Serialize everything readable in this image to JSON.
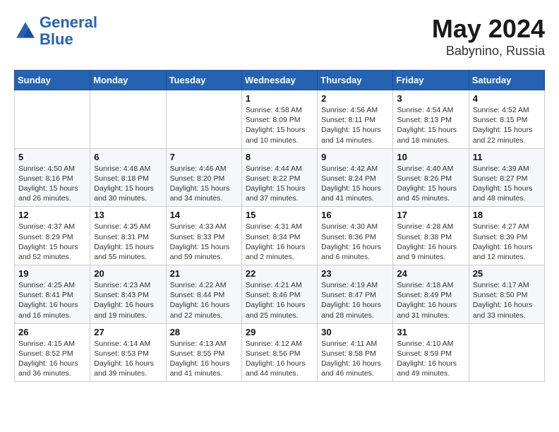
{
  "header": {
    "logo_line1": "General",
    "logo_line2": "Blue",
    "month_year": "May 2024",
    "location": "Babynino, Russia"
  },
  "weekdays": [
    "Sunday",
    "Monday",
    "Tuesday",
    "Wednesday",
    "Thursday",
    "Friday",
    "Saturday"
  ],
  "weeks": [
    [
      {
        "day": "",
        "info": ""
      },
      {
        "day": "",
        "info": ""
      },
      {
        "day": "",
        "info": ""
      },
      {
        "day": "1",
        "info": "Sunrise: 4:58 AM\nSunset: 8:09 PM\nDaylight: 15 hours\nand 10 minutes."
      },
      {
        "day": "2",
        "info": "Sunrise: 4:56 AM\nSunset: 8:11 PM\nDaylight: 15 hours\nand 14 minutes."
      },
      {
        "day": "3",
        "info": "Sunrise: 4:54 AM\nSunset: 8:13 PM\nDaylight: 15 hours\nand 18 minutes."
      },
      {
        "day": "4",
        "info": "Sunrise: 4:52 AM\nSunset: 8:15 PM\nDaylight: 15 hours\nand 22 minutes."
      }
    ],
    [
      {
        "day": "5",
        "info": "Sunrise: 4:50 AM\nSunset: 8:16 PM\nDaylight: 15 hours\nand 26 minutes."
      },
      {
        "day": "6",
        "info": "Sunrise: 4:48 AM\nSunset: 8:18 PM\nDaylight: 15 hours\nand 30 minutes."
      },
      {
        "day": "7",
        "info": "Sunrise: 4:46 AM\nSunset: 8:20 PM\nDaylight: 15 hours\nand 34 minutes."
      },
      {
        "day": "8",
        "info": "Sunrise: 4:44 AM\nSunset: 8:22 PM\nDaylight: 15 hours\nand 37 minutes."
      },
      {
        "day": "9",
        "info": "Sunrise: 4:42 AM\nSunset: 8:24 PM\nDaylight: 15 hours\nand 41 minutes."
      },
      {
        "day": "10",
        "info": "Sunrise: 4:40 AM\nSunset: 8:26 PM\nDaylight: 15 hours\nand 45 minutes."
      },
      {
        "day": "11",
        "info": "Sunrise: 4:39 AM\nSunset: 8:27 PM\nDaylight: 15 hours\nand 48 minutes."
      }
    ],
    [
      {
        "day": "12",
        "info": "Sunrise: 4:37 AM\nSunset: 8:29 PM\nDaylight: 15 hours\nand 52 minutes."
      },
      {
        "day": "13",
        "info": "Sunrise: 4:35 AM\nSunset: 8:31 PM\nDaylight: 15 hours\nand 55 minutes."
      },
      {
        "day": "14",
        "info": "Sunrise: 4:33 AM\nSunset: 8:33 PM\nDaylight: 15 hours\nand 59 minutes."
      },
      {
        "day": "15",
        "info": "Sunrise: 4:31 AM\nSunset: 8:34 PM\nDaylight: 16 hours\nand 2 minutes."
      },
      {
        "day": "16",
        "info": "Sunrise: 4:30 AM\nSunset: 8:36 PM\nDaylight: 16 hours\nand 6 minutes."
      },
      {
        "day": "17",
        "info": "Sunrise: 4:28 AM\nSunset: 8:38 PM\nDaylight: 16 hours\nand 9 minutes."
      },
      {
        "day": "18",
        "info": "Sunrise: 4:27 AM\nSunset: 8:39 PM\nDaylight: 16 hours\nand 12 minutes."
      }
    ],
    [
      {
        "day": "19",
        "info": "Sunrise: 4:25 AM\nSunset: 8:41 PM\nDaylight: 16 hours\nand 16 minutes."
      },
      {
        "day": "20",
        "info": "Sunrise: 4:23 AM\nSunset: 8:43 PM\nDaylight: 16 hours\nand 19 minutes."
      },
      {
        "day": "21",
        "info": "Sunrise: 4:22 AM\nSunset: 8:44 PM\nDaylight: 16 hours\nand 22 minutes."
      },
      {
        "day": "22",
        "info": "Sunrise: 4:21 AM\nSunset: 8:46 PM\nDaylight: 16 hours\nand 25 minutes."
      },
      {
        "day": "23",
        "info": "Sunrise: 4:19 AM\nSunset: 8:47 PM\nDaylight: 16 hours\nand 28 minutes."
      },
      {
        "day": "24",
        "info": "Sunrise: 4:18 AM\nSunset: 8:49 PM\nDaylight: 16 hours\nand 31 minutes."
      },
      {
        "day": "25",
        "info": "Sunrise: 4:17 AM\nSunset: 8:50 PM\nDaylight: 16 hours\nand 33 minutes."
      }
    ],
    [
      {
        "day": "26",
        "info": "Sunrise: 4:15 AM\nSunset: 8:52 PM\nDaylight: 16 hours\nand 36 minutes."
      },
      {
        "day": "27",
        "info": "Sunrise: 4:14 AM\nSunset: 8:53 PM\nDaylight: 16 hours\nand 39 minutes."
      },
      {
        "day": "28",
        "info": "Sunrise: 4:13 AM\nSunset: 8:55 PM\nDaylight: 16 hours\nand 41 minutes."
      },
      {
        "day": "29",
        "info": "Sunrise: 4:12 AM\nSunset: 8:56 PM\nDaylight: 16 hours\nand 44 minutes."
      },
      {
        "day": "30",
        "info": "Sunrise: 4:11 AM\nSunset: 8:58 PM\nDaylight: 16 hours\nand 46 minutes."
      },
      {
        "day": "31",
        "info": "Sunrise: 4:10 AM\nSunset: 8:59 PM\nDaylight: 16 hours\nand 49 minutes."
      },
      {
        "day": "",
        "info": ""
      }
    ]
  ]
}
